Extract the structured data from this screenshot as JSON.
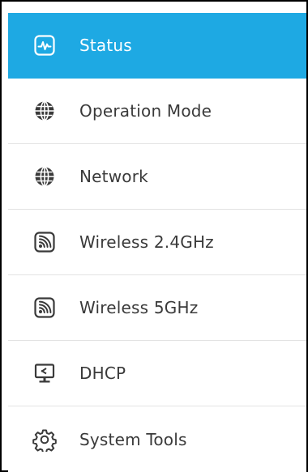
{
  "menu": {
    "items": [
      {
        "label": "Status",
        "icon": "activity-monitor-icon",
        "active": true
      },
      {
        "label": "Operation Mode",
        "icon": "globe-icon",
        "active": false
      },
      {
        "label": "Network",
        "icon": "globe-icon",
        "active": false
      },
      {
        "label": "Wireless 2.4GHz",
        "icon": "wireless-icon",
        "active": false
      },
      {
        "label": "Wireless 5GHz",
        "icon": "wireless-icon",
        "active": false
      },
      {
        "label": "DHCP",
        "icon": "dhcp-monitor-icon",
        "active": false
      },
      {
        "label": "System Tools",
        "icon": "gear-icon",
        "active": false
      }
    ]
  },
  "colors": {
    "active_background": "#1ea9e3",
    "active_text": "#ffffff",
    "text": "#3a3a3a",
    "divider": "#e3e3e3",
    "frame_border": "#000000"
  }
}
